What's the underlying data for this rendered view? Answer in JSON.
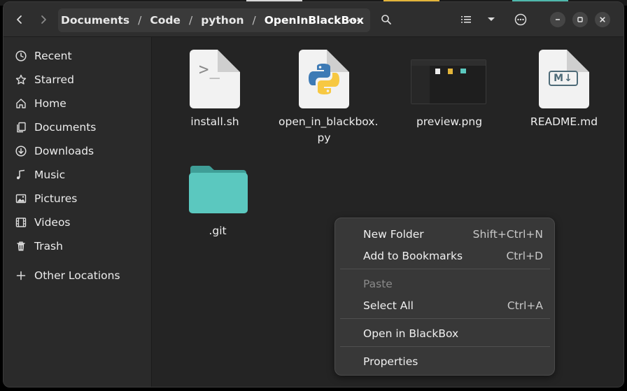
{
  "pathbar": {
    "crumbs": [
      "Documents",
      "Code",
      "python",
      "OpenInBlackBox"
    ],
    "separator": "/"
  },
  "sidebar": {
    "items": [
      {
        "label": "Recent",
        "icon": "clock-icon"
      },
      {
        "label": "Starred",
        "icon": "star-icon"
      },
      {
        "label": "Home",
        "icon": "home-icon"
      },
      {
        "label": "Documents",
        "icon": "documents-icon"
      },
      {
        "label": "Downloads",
        "icon": "downloads-icon"
      },
      {
        "label": "Music",
        "icon": "music-icon"
      },
      {
        "label": "Pictures",
        "icon": "pictures-icon"
      },
      {
        "label": "Videos",
        "icon": "videos-icon"
      },
      {
        "label": "Trash",
        "icon": "trash-icon"
      },
      {
        "label": "Other Locations",
        "icon": "plus-icon"
      }
    ]
  },
  "files": [
    {
      "name": "install.sh",
      "type": "shell-script"
    },
    {
      "name": "open_in_blackbox.",
      "name2": "py",
      "type": "python"
    },
    {
      "name": "preview.png",
      "type": "image"
    },
    {
      "name": "README.md",
      "type": "markdown"
    },
    {
      "name": ".git",
      "type": "folder"
    }
  ],
  "icons": {
    "script_glyph": ">_",
    "markdown_glyph": "M↓"
  },
  "context_menu": {
    "items": [
      {
        "label": "New Folder",
        "accel": "Shift+Ctrl+N",
        "enabled": true
      },
      {
        "label": "Add to Bookmarks",
        "accel": "Ctrl+D",
        "enabled": true
      },
      {
        "label": "Paste",
        "accel": "",
        "enabled": false
      },
      {
        "label": "Select All",
        "accel": "Ctrl+A",
        "enabled": true
      },
      {
        "label": "Open in BlackBox",
        "accel": "",
        "enabled": true
      },
      {
        "label": "Properties",
        "accel": "",
        "enabled": true
      }
    ]
  },
  "colors": {
    "folder": "#5bc8bf",
    "folder_tab": "#3f9e97",
    "window_bg": "#242424",
    "sidebar_bg": "#2a2a2a",
    "menu_bg": "#383838"
  }
}
